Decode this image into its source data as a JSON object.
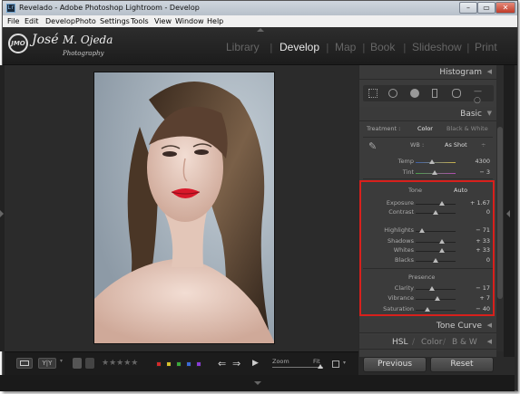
{
  "window": {
    "title": "Revelado - Adobe Photoshop Lightroom - Develop",
    "app_icon": "Lr"
  },
  "menu": [
    "File",
    "Edit",
    "Develop",
    "Photo",
    "Settings",
    "Tools",
    "View",
    "Window",
    "Help"
  ],
  "identity": {
    "badge": "JMO",
    "name": "José",
    "surname": "M. Ojeda",
    "sub": "Photography"
  },
  "modules": [
    {
      "label": "Library",
      "active": false
    },
    {
      "label": "Develop",
      "active": true
    },
    {
      "label": "Map",
      "active": false
    },
    {
      "label": "Book",
      "active": false
    },
    {
      "label": "Slideshow",
      "active": false
    },
    {
      "label": "Print",
      "active": false
    }
  ],
  "panels": {
    "histogram": {
      "label": "Histogram",
      "arrow": "◀"
    },
    "basic": {
      "label": "Basic",
      "arrow": "▼"
    },
    "tone_curve": {
      "label": "Tone Curve",
      "arrow": "◀"
    },
    "hsl": {
      "hsl": "HSL",
      "color": "Color",
      "bw": "B & W",
      "sep": "/",
      "arrow": "◀"
    }
  },
  "treatment": {
    "label": "Treatment :",
    "color": "Color",
    "bw": "Black & White"
  },
  "wb": {
    "label": "WB :",
    "value": "As Shot",
    "caret": "÷"
  },
  "tone_header": {
    "label": "Tone",
    "auto": "Auto"
  },
  "presence_header": {
    "label": "Presence"
  },
  "sliders": {
    "temp": {
      "label": "Temp",
      "value": "4300",
      "pos": 0.42
    },
    "tint": {
      "label": "Tint",
      "value": "− 3",
      "pos": 0.48
    },
    "exposure": {
      "label": "Exposure",
      "value": "+ 1.67",
      "pos": 0.66
    },
    "contrast": {
      "label": "Contrast",
      "value": "0",
      "pos": 0.5
    },
    "highlights": {
      "label": "Highlights",
      "value": "− 71",
      "pos": 0.15
    },
    "shadows": {
      "label": "Shadows",
      "value": "+ 33",
      "pos": 0.66
    },
    "whites": {
      "label": "Whites",
      "value": "+ 33",
      "pos": 0.66
    },
    "blacks": {
      "label": "Blacks",
      "value": "0",
      "pos": 0.5
    },
    "clarity": {
      "label": "Clarity",
      "value": "− 17",
      "pos": 0.42
    },
    "vibrance": {
      "label": "Vibrance",
      "value": "+ 7",
      "pos": 0.54
    },
    "saturation": {
      "label": "Saturation",
      "value": "− 40",
      "pos": 0.3
    }
  },
  "toolbar": {
    "zoom_label": "Zoom",
    "fit_label": "Fit",
    "stars": "★★★★★"
  },
  "color_labels": [
    "#d22a2a",
    "#d7c12b",
    "#3aa83a",
    "#3a6ad6",
    "#8a3ad6"
  ],
  "buttons": {
    "previous": "Previous",
    "reset": "Reset"
  }
}
